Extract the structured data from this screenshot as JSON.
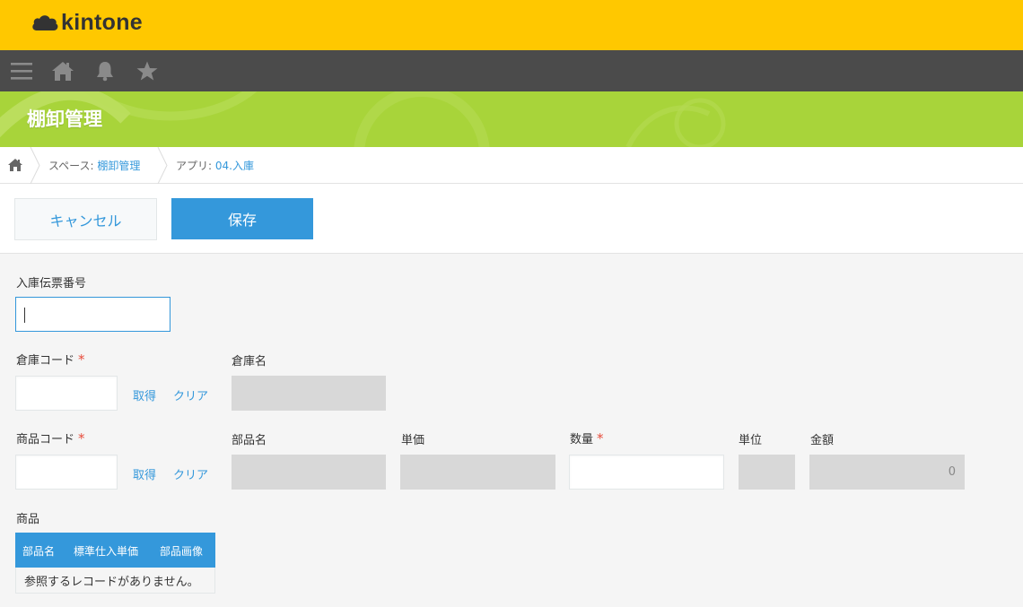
{
  "app": {
    "logo_text": "kintone"
  },
  "navbar": {
    "icons": [
      "menu-icon",
      "home-icon",
      "bell-icon",
      "star-icon"
    ]
  },
  "banner": {
    "title": "棚卸管理",
    "color": "#a8d43a"
  },
  "breadcrumb": {
    "space_prefix": "スペース: ",
    "space_name": "棚卸管理",
    "app_prefix": "アプリ: ",
    "app_name": "04.入庫"
  },
  "actions": {
    "cancel_label": "キャンセル",
    "save_label": "保存"
  },
  "form": {
    "receipt_number": {
      "label": "入庫伝票番号",
      "value": ""
    },
    "warehouse_code": {
      "label": "倉庫コード",
      "required_mark": "*",
      "value": "",
      "fetch_label": "取得",
      "clear_label": "クリア"
    },
    "warehouse_name": {
      "label": "倉庫名",
      "value": ""
    },
    "product_code": {
      "label": "商品コード",
      "required_mark": "*",
      "value": "",
      "fetch_label": "取得",
      "clear_label": "クリア"
    },
    "part_name": {
      "label": "部品名",
      "value": ""
    },
    "unit_price": {
      "label": "単価",
      "value": ""
    },
    "quantity": {
      "label": "数量",
      "required_mark": "*",
      "value": ""
    },
    "unit": {
      "label": "単位",
      "value": ""
    },
    "amount": {
      "label": "金額",
      "value": "0"
    },
    "product_ref": {
      "label": "商品",
      "columns": [
        "部品名",
        "標準仕入単価",
        "部品画像"
      ],
      "empty_message": "参照するレコードがありません。"
    }
  },
  "colors": {
    "topbar": "#ffc800",
    "navbar": "#4b4b4b",
    "accent": "#3498db",
    "required": "#e74c3c",
    "readonly_field": "#d8d8d8"
  }
}
